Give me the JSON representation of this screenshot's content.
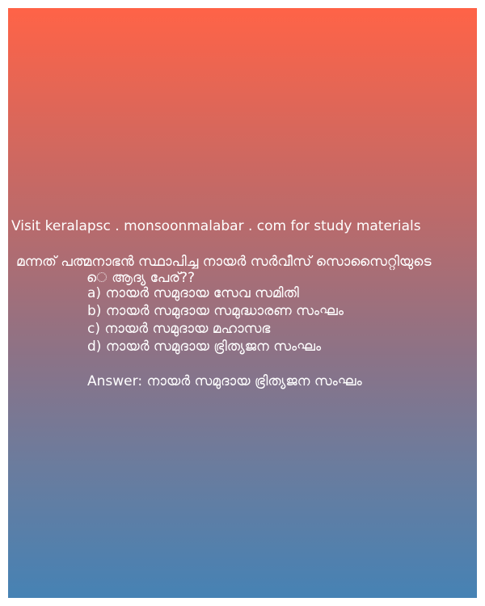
{
  "site_text": "Visit keralapsc . monsoonmalabar . com for study materials",
  "question": {
    "line1": "മന്നത് പത്മനാഭൻ സ്ഥാപിച്ച നായർ സർവീസ് സൊസൈറ്റിയുടെ",
    "line2": "െ ആദ്യ പേര്??"
  },
  "options": [
    "a) നായർ സമുദായ സേവ സമിതി",
    "b) നായർ സമുദായ സമുദ്ധാരണ സംഘം",
    "c) നായർ സമുദായ മഹാസഭ",
    "d) നായർ സമുദായ ഭ്രിത്യജന സംഘം"
  ],
  "answer": "Answer: നായർ സമുദായ ഭ്രിത്യജന സംഘം",
  "colors": {
    "gradient_top": "#ff6347",
    "gradient_bottom": "#4682b4",
    "text": "#ffffff"
  }
}
